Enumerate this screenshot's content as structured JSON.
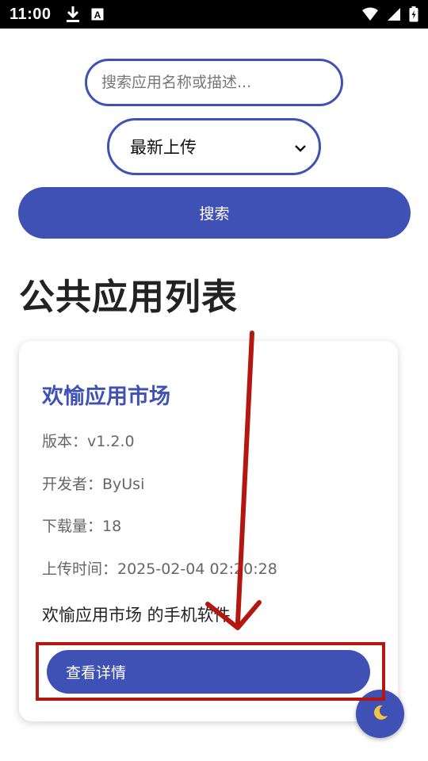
{
  "status_bar": {
    "time": "11:00",
    "left_icons": [
      "download-icon",
      "a-translate-icon"
    ],
    "right_icons": [
      "wifi-icon",
      "signal-icon",
      "battery-icon"
    ]
  },
  "search": {
    "placeholder": "搜索应用名称或描述...",
    "value": "",
    "button_label": "搜索"
  },
  "sort": {
    "selected": "最新上传"
  },
  "page": {
    "title": "公共应用列表"
  },
  "app_card": {
    "name": "欢愉应用市场",
    "version": "版本：v1.2.0",
    "developer": "开发者：ByUsi",
    "downloads": "下载量：18",
    "upload_time": "上传时间：2025-02-04 02:20:28",
    "description": "欢愉应用市场 的手机软件",
    "details_button": "查看详情"
  },
  "theme_toggle": {
    "icon": "moon-icon"
  },
  "colors": {
    "accent": "#3f51b5",
    "annotation": "#b3170f"
  }
}
